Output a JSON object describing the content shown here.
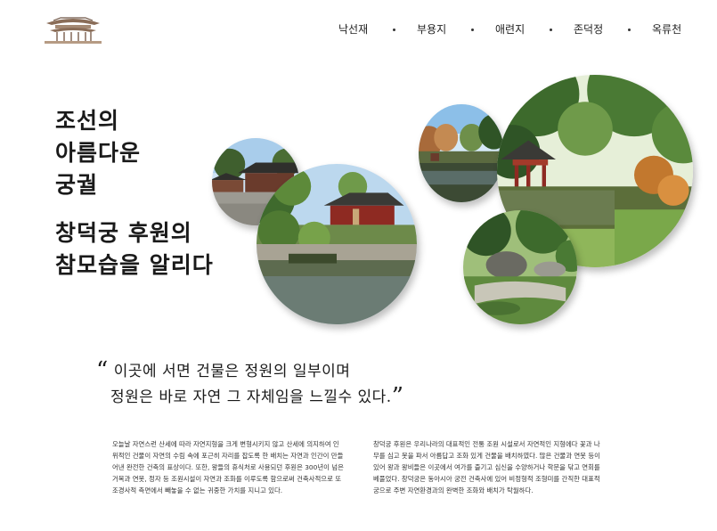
{
  "nav": {
    "items": [
      "낙선재",
      "부용지",
      "애련지",
      "존덕정",
      "옥류천"
    ]
  },
  "headline": {
    "line1": "조선의",
    "line2": "아름다운",
    "line3": "궁궐",
    "line4": "창덕궁 후원의",
    "line5": "참모습을 알리다"
  },
  "quote": {
    "open": "“",
    "line1": "이곳에 서면 건물은 정원의 일부이며",
    "line2": "정원은 바로 자연 그 자체임을 느낄수 있다.",
    "close": "”"
  },
  "paragraph_left": "오늘날 자연스런 산세에 따라 자연지형을 크게 변형시키지 않고 산세에 의지하여 인위적인 건물이 자연의 수림 속에 포근히 자리를 잡도록 한 배치는 자연과 인간이 만들어낸 완전한 건축의 표상이다. 또한, 왕들의 휴식처로 사용되던 후원은 300년이 넘은 거목과 연못, 정자 등 조원시설이 자연과 조화를 이루도록 함으로써 건축사적으로 또 조경사적 측면에서 빼놓을 수 없는 귀중한 가치를 지니고 있다.",
  "paragraph_right": "창덕궁 후원은 우리나라의 대표적인 전통 조원 시설로서 자연적인 지형에다 꽃과 나무를 심고 못을 파서 아름답고 조화 있게 건물을 배치하였다. 많은 건물과 연못 등이 있어 왕과 왕비들은 이곳에서 여가를 즐기고 심신을 수양하거나 학문을 닦고 연회를 베풀었다. 창덕궁은 동아시아 궁전 건축사에 있어 비정형적 조형미를 간직한 대표적 궁으로 주변 자연환경과의 완벽한 조화와 배치가 탁월하다.",
  "colors": {
    "text": "#1a1a1a",
    "foliage": "#4f7a32",
    "sky": "#8cbfe8",
    "water": "#556a50",
    "roof": "#3a3a36",
    "pillar": "#8e2a22"
  },
  "icons": [
    "palace-logo-icon"
  ]
}
